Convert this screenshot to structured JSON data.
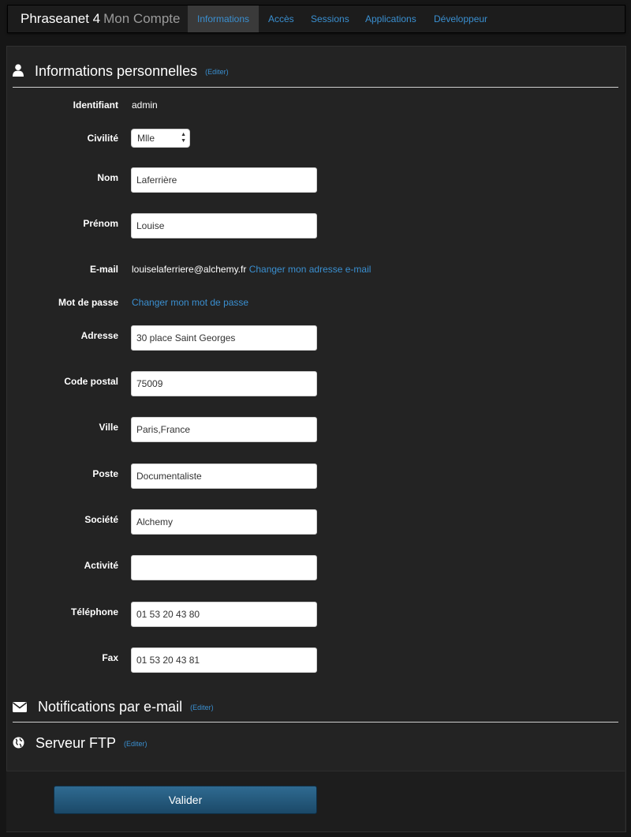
{
  "navbar": {
    "brand": "Phraseanet 4",
    "brand_sub": "Mon Compte",
    "tabs": [
      {
        "label": "Informations"
      },
      {
        "label": "Accès"
      },
      {
        "label": "Sessions"
      },
      {
        "label": "Applications"
      },
      {
        "label": "Développeur"
      }
    ]
  },
  "personal": {
    "title": "Informations personnelles",
    "edit": "(Editer)",
    "identifiant_label": "Identifiant",
    "identifiant_value": "admin",
    "civilite_label": "Civilité",
    "civilite_value": "Mlle",
    "nom_label": "Nom",
    "nom_value": "Laferrière",
    "prenom_label": "Prénom",
    "prenom_value": "Louise",
    "email_label": "E-mail",
    "email_value": "louiselaferriere@alchemy.fr",
    "email_change": "Changer mon adresse e-mail",
    "password_label": "Mot de passe",
    "password_change": "Changer mon mot de passe",
    "adresse_label": "Adresse",
    "adresse_value": "30 place Saint Georges",
    "cp_label": "Code postal",
    "cp_value": "75009",
    "ville_label": "Ville",
    "ville_value": "Paris,France",
    "poste_label": "Poste",
    "poste_value": "Documentaliste",
    "societe_label": "Société",
    "societe_value": "Alchemy",
    "activite_label": "Activité",
    "activite_value": "",
    "telephone_label": "Téléphone",
    "telephone_value": "01 53 20 43 80",
    "fax_label": "Fax",
    "fax_value": "01 53 20 43 81"
  },
  "notifications": {
    "title": "Notifications par e-mail",
    "edit": "(Editer)"
  },
  "ftp": {
    "title": "Serveur FTP",
    "edit": "(Editer)"
  },
  "footer": {
    "submit": "Valider"
  },
  "icons": {
    "personal": "user-icon",
    "notifications": "envelope-icon",
    "ftp": "globe-icon"
  },
  "colors": {
    "link": "#3a8fd0",
    "background": "#161616",
    "panel": "#232323",
    "button": "#245a7e"
  }
}
